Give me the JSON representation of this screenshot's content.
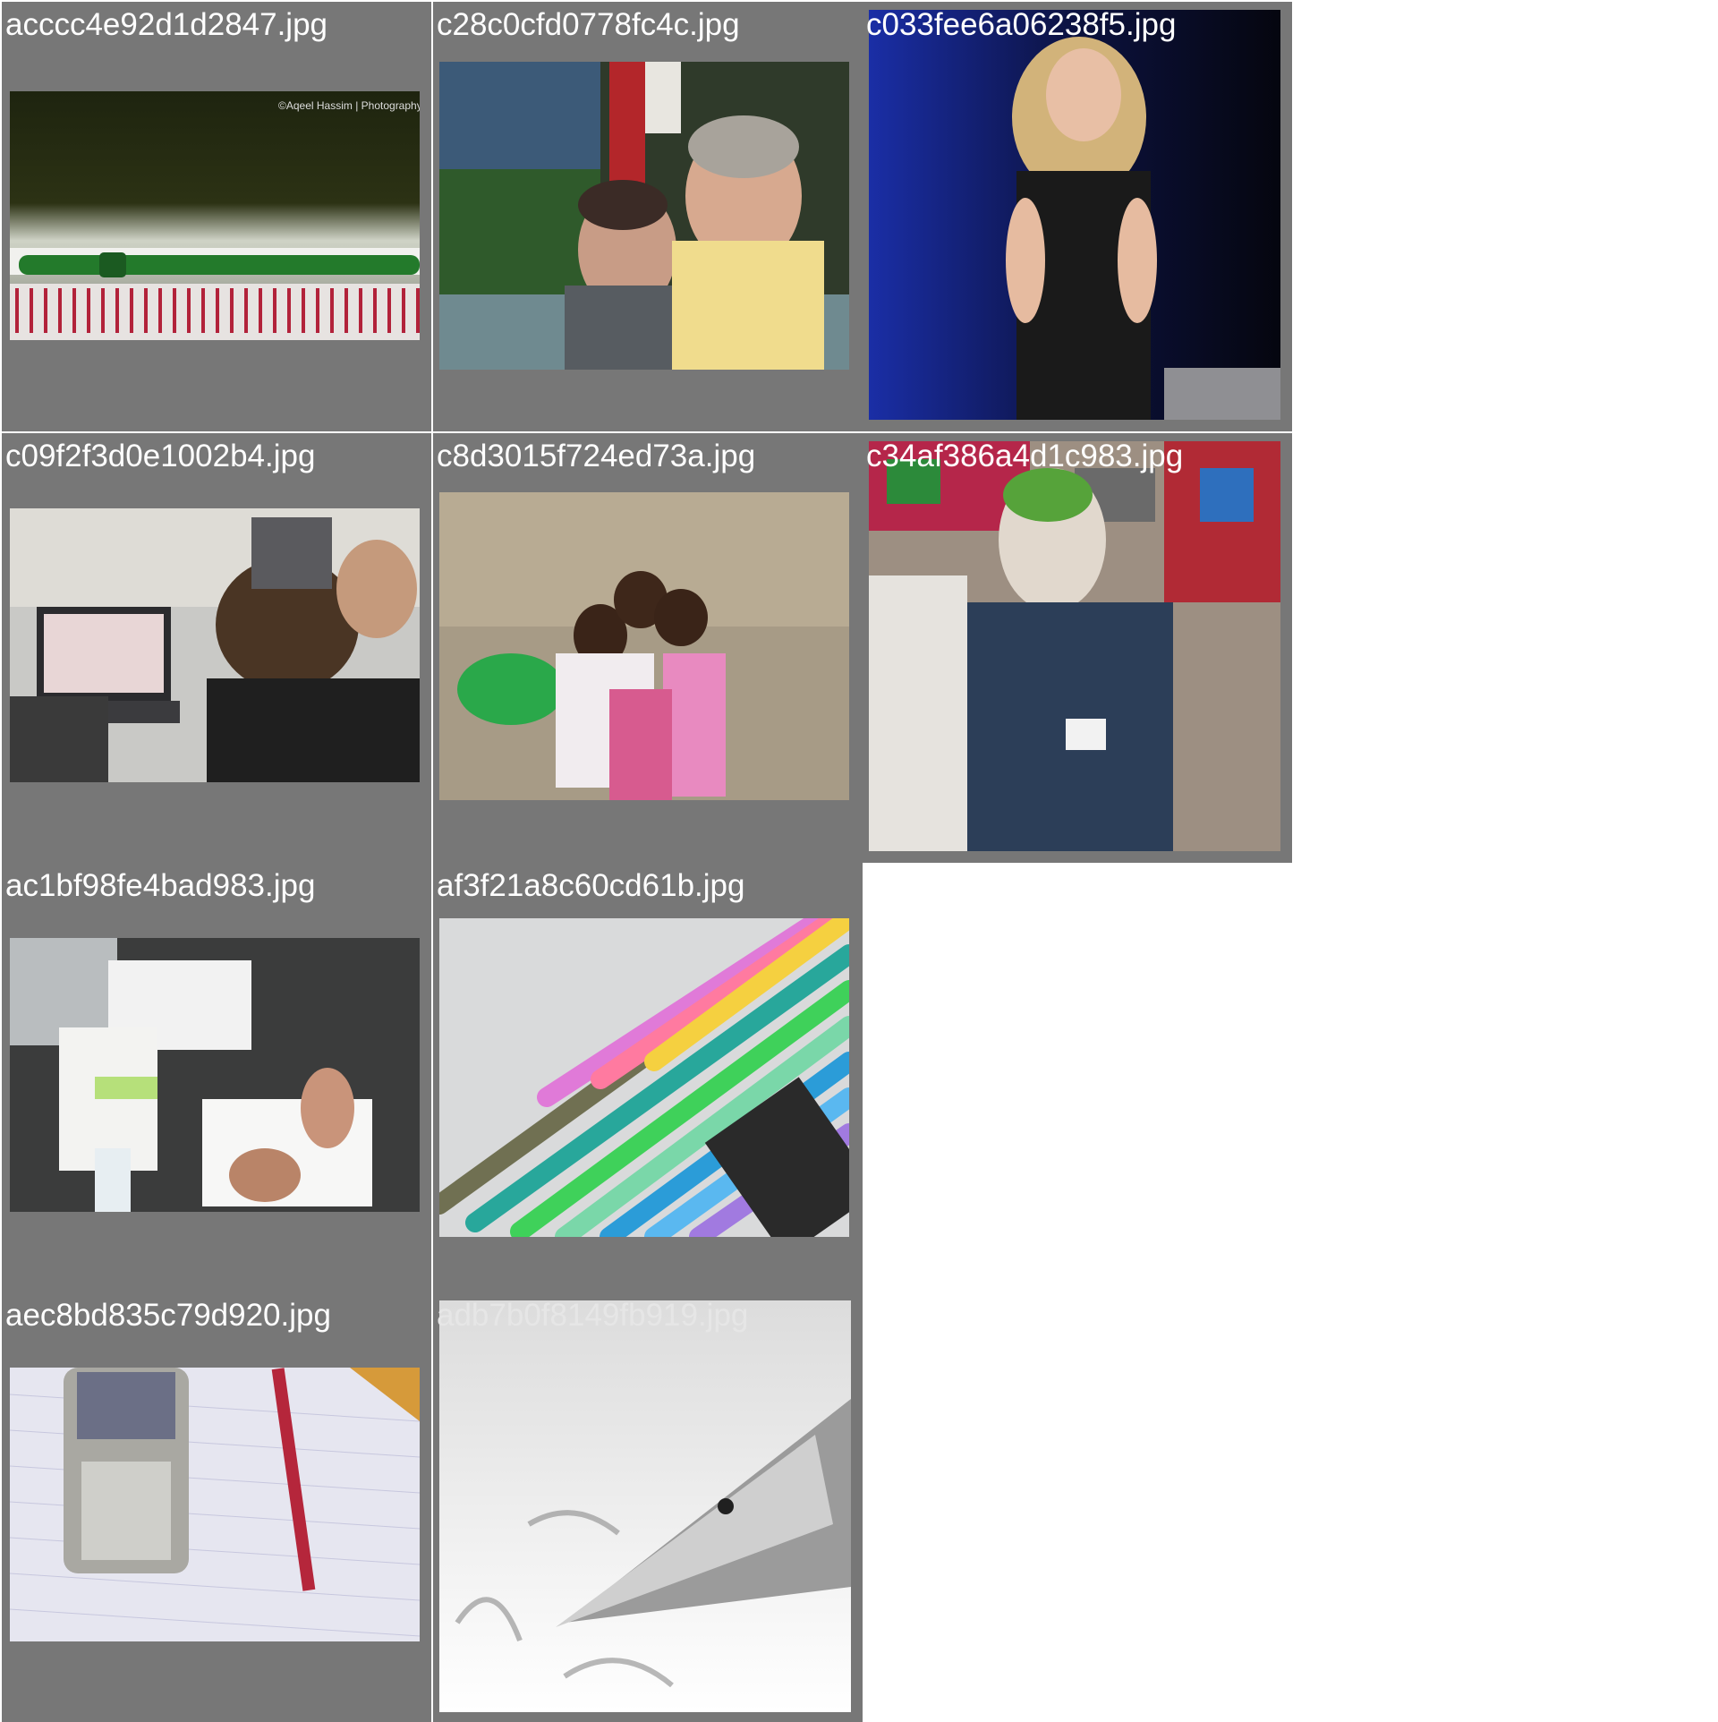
{
  "gallery": {
    "tiles": [
      {
        "filename": "acccc4e92d1d2847.jpg",
        "subject": "green-pen-on-notebook",
        "watermark": "©Aqeel Hassim | Photography"
      },
      {
        "filename": "c28c0cfd0778fc4c.jpg",
        "subject": "couple-smiling"
      },
      {
        "filename": "c033fee6a06238f5.jpg",
        "subject": "woman-speaker-on-stage"
      },
      {
        "filename": "c09f2f3d0e1002b4.jpg",
        "subject": "people-at-laptops"
      },
      {
        "filename": "c8d3015f724ed73a.jpg",
        "subject": "children-hugging"
      },
      {
        "filename": "c34af386a4d1c983.jpg",
        "subject": "joker-costume-man"
      },
      {
        "filename": "ac1bf98fe4bad983.jpg",
        "subject": "papers-and-pens-on-table"
      },
      {
        "filename": "af3f21a8c60cd61b.jpg",
        "subject": "colorful-gel-pens"
      },
      {
        "filename": "aec8bd835c79d920.jpg",
        "subject": "phone-and-pen-on-paper"
      },
      {
        "filename": "adb7b0f8149fb919.jpg",
        "subject": "fountain-pen-nib"
      }
    ]
  },
  "colors": {
    "tile_background": "#777777",
    "page_background": "#ffffff",
    "filename_text": "#ffffff"
  }
}
